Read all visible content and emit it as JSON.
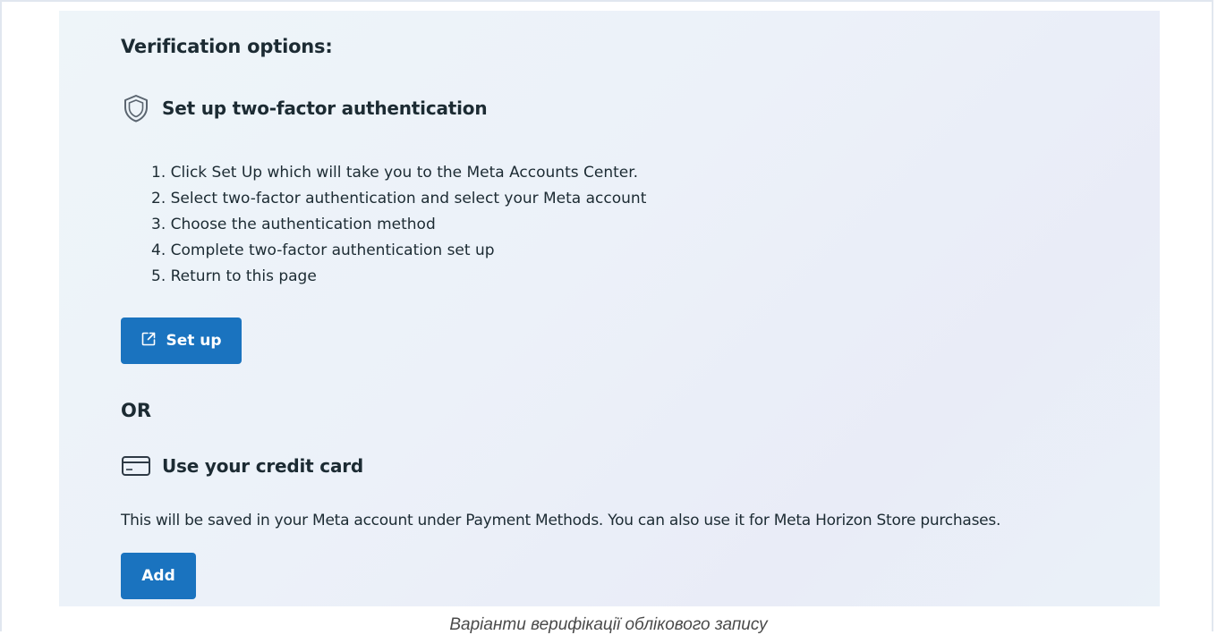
{
  "verification": {
    "heading": "Verification options:",
    "two_factor": {
      "title": "Set up two-factor authentication",
      "icon": "shield-icon",
      "steps": [
        "1. Click Set Up which will take you to the Meta Accounts Center.",
        "2. Select two-factor authentication and select your Meta account",
        "3. Choose the authentication method",
        "4. Complete two-factor authentication set up",
        "5. Return to this page"
      ],
      "button_label": "Set up",
      "button_icon": "external-link-icon"
    },
    "or_label": "OR",
    "credit_card": {
      "title": "Use your credit card",
      "icon": "credit-card-icon",
      "description": "This will be saved in your Meta account under Payment Methods. You can also use it for Meta Horizon Store purchases.",
      "button_label": "Add"
    }
  },
  "caption": "Варіанти верифікації облікового запису",
  "colors": {
    "primary_button": "#1a73bf",
    "text": "#1c2b33",
    "panel_background": "#ecf1f9"
  }
}
